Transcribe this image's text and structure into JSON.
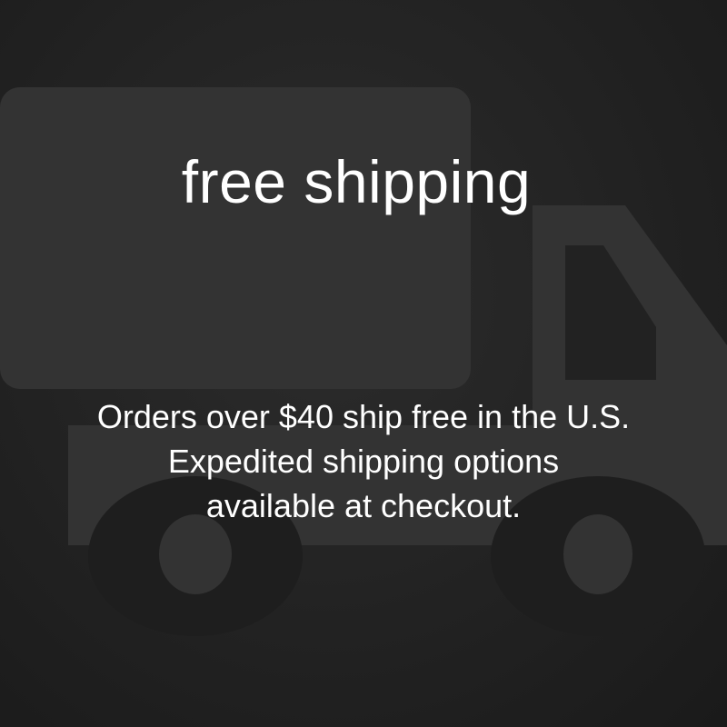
{
  "headline": "free shipping",
  "body_lines": [
    "Orders over $40 ship free in the U.S.",
    "Expedited shipping options",
    "available at checkout."
  ],
  "background_icon": "truck-icon",
  "colors": {
    "background": "#222222",
    "icon": "#333333",
    "text": "#ffffff"
  }
}
